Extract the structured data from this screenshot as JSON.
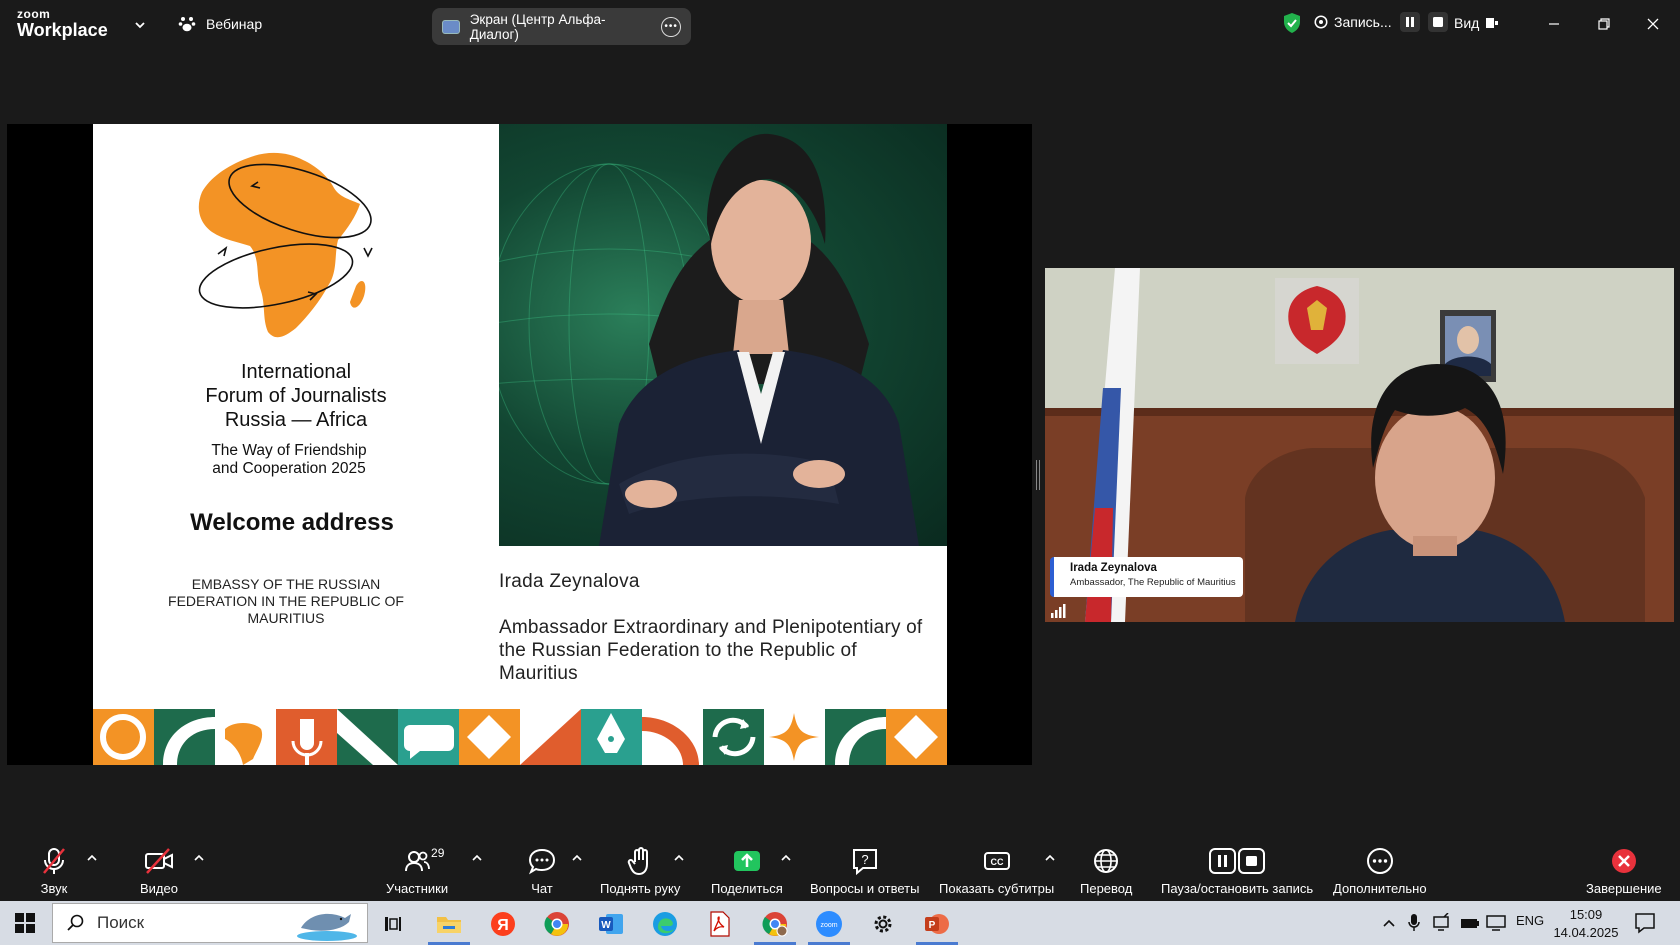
{
  "titlebar": {
    "logo_top": "zoom",
    "logo_bottom": "Workplace",
    "webinar_label": "Вебинар",
    "screen_share_label": "Экран (Центр Альфа-Диалог)",
    "recording_label": "Запись...",
    "view_label": "Вид"
  },
  "slide": {
    "forum_title": [
      "International",
      "Forum of Journalists",
      "Russia — Africa"
    ],
    "forum_subtitle": [
      "The Way of Friendship",
      "and Cooperation 2025"
    ],
    "welcome": "Welcome address",
    "embassy": "EMBASSY OF THE RUSSIAN FEDERATION IN THE REPUBLIC OF MAURITIUS",
    "speaker_name": "Irada Zeynalova",
    "speaker_role": "Ambassador Extraordinary and Plenipotentiary of the Russian Federation to the Republic of Mauritius"
  },
  "participant": {
    "name": "Irada Zeynalova",
    "role": "Ambassador, The Republic of Mauritius"
  },
  "toolbar": {
    "audio": "Звук",
    "video": "Видео",
    "participants": "Участники",
    "participants_count": "29",
    "chat": "Чат",
    "raise_hand": "Поднять руку",
    "share": "Поделиться",
    "qa": "Вопросы и ответы",
    "captions": "Показать субтитры",
    "translate": "Перевод",
    "pause_record": "Пауза/остановить запись",
    "more": "Дополнительно",
    "end": "Завершение"
  },
  "taskbar": {
    "search_placeholder": "Поиск",
    "language": "ENG",
    "time": "15:09",
    "date": "14.04.2025"
  },
  "colors": {
    "orange": "#f39325",
    "green": "#1e6b4c",
    "teal": "#2aa08f",
    "accent_blue": "#2d5fd3"
  }
}
